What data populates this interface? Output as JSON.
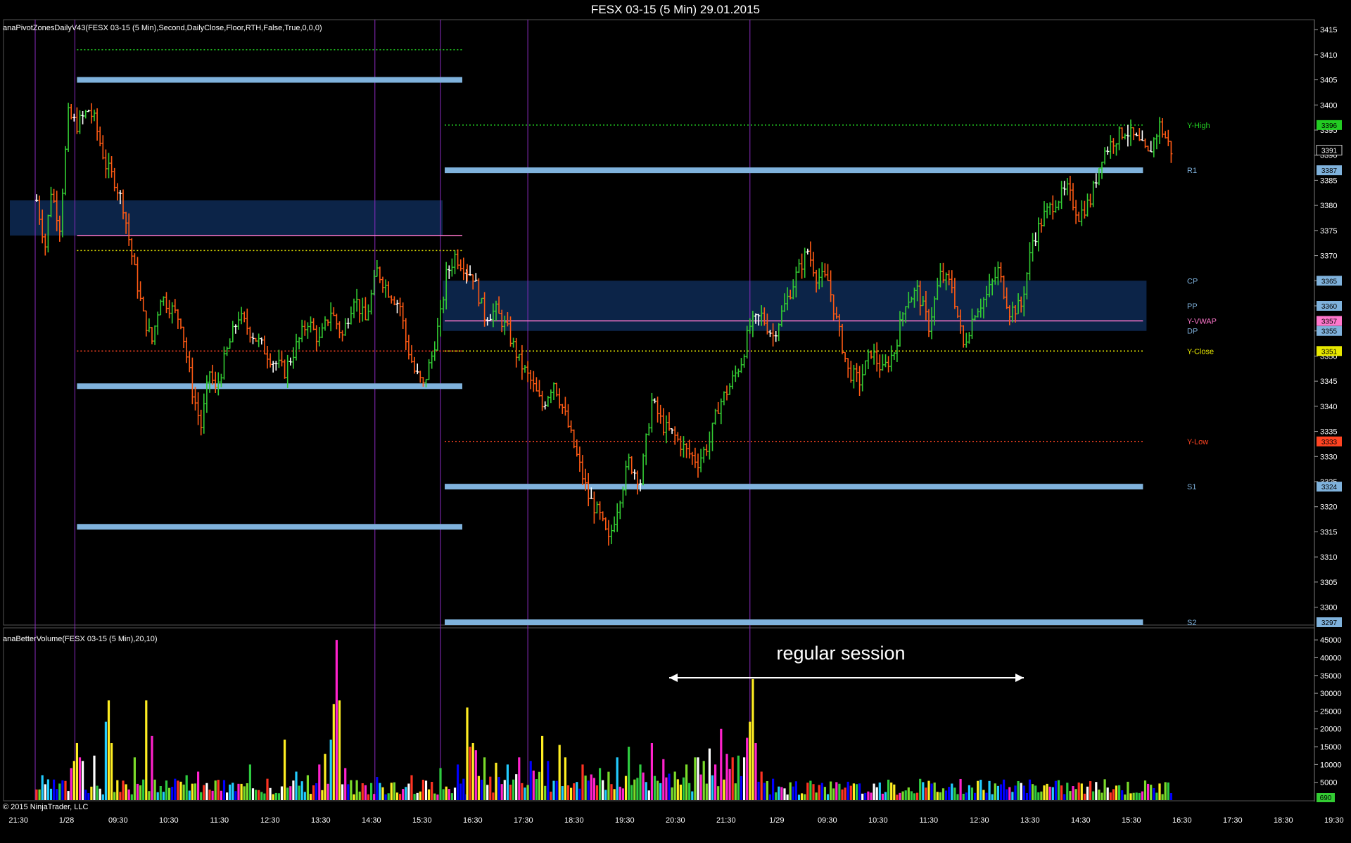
{
  "window": {
    "title": "FESX 03-15 (5 Min)  29.01.2015",
    "copyright": "© 2015 NinjaTrader, LLC"
  },
  "colors": {
    "background": "#000000",
    "up_bar": "#33cc33",
    "down_bar": "#ff5a14",
    "pivot_zone": "#7fb2dc",
    "zone_fill": "#0e2a55",
    "y_high": "#22cc22",
    "y_low": "#ff4422",
    "y_close": "#e8e800",
    "y_vwap": "#ff77cc",
    "session_line": "#8a2bbf"
  },
  "chart_data": [
    {
      "type": "candlestick",
      "indicator_label": "anaPivotZonesDailyV43(FESX 03-15 (5 Min),Second,DailyClose,Floor,RTH,False,True,0,0,0)",
      "y_ticks": [
        3300,
        3305,
        3310,
        3315,
        3320,
        3325,
        3330,
        3335,
        3340,
        3345,
        3350,
        3355,
        3360,
        3365,
        3370,
        3375,
        3380,
        3385,
        3390,
        3395,
        3400,
        3405,
        3410,
        3415
      ],
      "ylim": [
        3297,
        3416
      ],
      "x_ticks": [
        "21:30",
        "1/28",
        "09:30",
        "10:30",
        "11:30",
        "12:30",
        "13:30",
        "14:30",
        "15:30",
        "16:30",
        "17:30",
        "18:30",
        "19:30",
        "20:30",
        "21:30",
        "1/29",
        "09:30",
        "10:30",
        "11:30",
        "12:30",
        "13:30",
        "14:30",
        "15:30",
        "16:30",
        "17:30",
        "18:30",
        "19:30",
        "20:30"
      ],
      "price_path": [
        [
          0,
          3381
        ],
        [
          3,
          3372
        ],
        [
          5,
          3383
        ],
        [
          8,
          3376
        ],
        [
          11,
          3398
        ],
        [
          14,
          3396
        ],
        [
          18,
          3399
        ],
        [
          20,
          3397
        ],
        [
          24,
          3388
        ],
        [
          27,
          3385
        ],
        [
          30,
          3380
        ],
        [
          33,
          3370
        ],
        [
          37,
          3358
        ],
        [
          40,
          3353
        ],
        [
          43,
          3362
        ],
        [
          46,
          3360
        ],
        [
          50,
          3357
        ],
        [
          54,
          3343
        ],
        [
          57,
          3336
        ],
        [
          60,
          3347
        ],
        [
          62,
          3343
        ],
        [
          66,
          3351
        ],
        [
          70,
          3358
        ],
        [
          74,
          3355
        ],
        [
          78,
          3352
        ],
        [
          82,
          3349
        ],
        [
          86,
          3347
        ],
        [
          90,
          3352
        ],
        [
          94,
          3357
        ],
        [
          98,
          3353
        ],
        [
          102,
          3359
        ],
        [
          106,
          3354
        ],
        [
          110,
          3362
        ],
        [
          114,
          3357
        ],
        [
          118,
          3367
        ],
        [
          122,
          3363
        ],
        [
          126,
          3360
        ],
        [
          128,
          3353
        ],
        [
          131,
          3347
        ],
        [
          134,
          3344
        ],
        [
          137,
          3350
        ],
        [
          140,
          3358
        ],
        [
          142,
          3366
        ],
        [
          145,
          3370
        ],
        [
          148,
          3368
        ],
        [
          152,
          3366
        ],
        [
          156,
          3358
        ],
        [
          160,
          3359
        ],
        [
          164,
          3355
        ],
        [
          168,
          3349
        ],
        [
          172,
          3345
        ],
        [
          176,
          3340
        ],
        [
          180,
          3345
        ],
        [
          184,
          3338
        ],
        [
          188,
          3330
        ],
        [
          192,
          3322
        ],
        [
          196,
          3318
        ],
        [
          199,
          3313
        ],
        [
          202,
          3320
        ],
        [
          206,
          3329
        ],
        [
          210,
          3325
        ],
        [
          214,
          3341
        ],
        [
          218,
          3336
        ],
        [
          222,
          3334
        ],
        [
          226,
          3331
        ],
        [
          230,
          3329
        ],
        [
          234,
          3333
        ],
        [
          237,
          3340
        ],
        [
          241,
          3344
        ],
        [
          245,
          3349
        ],
        [
          248,
          3356
        ],
        [
          252,
          3358
        ],
        [
          256,
          3354
        ],
        [
          260,
          3360
        ],
        [
          264,
          3366
        ],
        [
          268,
          3371
        ],
        [
          271,
          3366
        ],
        [
          275,
          3365
        ],
        [
          278,
          3357
        ],
        [
          282,
          3347
        ],
        [
          286,
          3345
        ],
        [
          290,
          3351
        ],
        [
          294,
          3347
        ],
        [
          298,
          3351
        ],
        [
          302,
          3361
        ],
        [
          306,
          3363
        ],
        [
          310,
          3356
        ],
        [
          314,
          3366
        ],
        [
          318,
          3364
        ],
        [
          322,
          3352
        ],
        [
          326,
          3359
        ],
        [
          330,
          3362
        ],
        [
          334,
          3367
        ],
        [
          338,
          3359
        ],
        [
          342,
          3360
        ],
        [
          346,
          3373
        ],
        [
          350,
          3378
        ],
        [
          354,
          3381
        ],
        [
          358,
          3383
        ],
        [
          362,
          3378
        ],
        [
          366,
          3381
        ],
        [
          370,
          3390
        ],
        [
          374,
          3393
        ],
        [
          378,
          3395
        ],
        [
          382,
          3393
        ],
        [
          386,
          3390
        ],
        [
          390,
          3396
        ],
        [
          394,
          3391
        ]
      ],
      "session_breaks": [
        14,
        118,
        171,
        248
      ],
      "right_session_start": 150,
      "levels_left": [
        {
          "price": 3411,
          "style": "dotted",
          "color": "y_high",
          "x0": 14,
          "x1": 150
        },
        {
          "price": 3405,
          "style": "band",
          "color": "pivot_zone",
          "x0": 14,
          "x1": 150
        },
        {
          "price": 3374,
          "style": "line",
          "color": "y_vwap",
          "x0": 14,
          "x1": 150
        },
        {
          "price": 3371,
          "style": "dotted",
          "color": "y_close",
          "x0": 14,
          "x1": 150
        },
        {
          "price": 3351,
          "style": "dotted",
          "color": "y_low",
          "x0": 14,
          "x1": 150
        },
        {
          "price": 3344,
          "style": "band",
          "color": "pivot_zone",
          "x0": 14,
          "x1": 150
        },
        {
          "price": 3316,
          "style": "band",
          "color": "pivot_zone",
          "x0": 14,
          "x1": 150
        }
      ],
      "zones_left": [
        [
          3381,
          3374
        ]
      ],
      "levels_right": [
        {
          "label": "Y-High",
          "price": 3396,
          "style": "dotted",
          "color": "y_high",
          "tag": "3396"
        },
        {
          "label": "R1",
          "price": 3387,
          "style": "band",
          "color": "pivot_zone",
          "tag": "3387"
        },
        {
          "label": "CP",
          "price": 3365,
          "style": "none",
          "color": "pivot_zone",
          "tag": "3365"
        },
        {
          "label": "PP",
          "price": 3360,
          "style": "none",
          "color": "pivot_zone",
          "tag": "3360"
        },
        {
          "label": "Y-VWAP",
          "price": 3357,
          "style": "line",
          "color": "y_vwap",
          "tag": "3357"
        },
        {
          "label": "DP",
          "price": 3355,
          "style": "none",
          "color": "pivot_zone",
          "tag": "3355"
        },
        {
          "label": "Y-Close",
          "price": 3351,
          "style": "dotted",
          "color": "y_close",
          "tag": "3351"
        },
        {
          "label": "Y-Low",
          "price": 3333,
          "style": "dotted",
          "color": "y_low",
          "tag": "3333"
        },
        {
          "label": "S1",
          "price": 3324,
          "style": "band",
          "color": "pivot_zone",
          "tag": "3324"
        },
        {
          "label": "S2",
          "price": 3297,
          "style": "band",
          "color": "pivot_zone",
          "tag": "3297"
        }
      ],
      "zones_right": [
        [
          3365,
          3360
        ],
        [
          3360,
          3355
        ]
      ],
      "last_price": "3391"
    },
    {
      "type": "bar",
      "indicator_label": "anaBetterVolume(FESX 03-15 (5 Min),20,10)",
      "y_ticks": [
        5000,
        10000,
        15000,
        20000,
        25000,
        30000,
        35000,
        40000,
        45000
      ],
      "ylim": [
        0,
        47000
      ],
      "annotation": "regular session",
      "annotation_range": [
        149,
        248
      ],
      "last_volume": "690",
      "spikes": [
        [
          1,
          3000
        ],
        [
          2,
          7000
        ],
        [
          12,
          9000
        ],
        [
          13,
          11000
        ],
        [
          14,
          16000
        ],
        [
          15,
          12000
        ],
        [
          16,
          11000
        ],
        [
          20,
          12500
        ],
        [
          24,
          22000
        ],
        [
          25,
          28000
        ],
        [
          26,
          16000
        ],
        [
          34,
          12000
        ],
        [
          38,
          28000
        ],
        [
          40,
          18000
        ],
        [
          45,
          5500
        ],
        [
          48,
          6000
        ],
        [
          52,
          7000
        ],
        [
          56,
          8000
        ],
        [
          62,
          5500
        ],
        [
          74,
          10000
        ],
        [
          80,
          6000
        ],
        [
          86,
          17000
        ],
        [
          90,
          8000
        ],
        [
          94,
          7000
        ],
        [
          98,
          10000
        ],
        [
          100,
          13000
        ],
        [
          102,
          17000
        ],
        [
          103,
          27000
        ],
        [
          104,
          45000
        ],
        [
          105,
          28000
        ],
        [
          107,
          9000
        ],
        [
          118,
          6500
        ],
        [
          124,
          5000
        ],
        [
          130,
          7000
        ],
        [
          140,
          9000
        ],
        [
          146,
          10000
        ],
        [
          148,
          6000
        ],
        [
          150,
          26000
        ],
        [
          151,
          15000
        ],
        [
          152,
          16000
        ],
        [
          153,
          14000
        ],
        [
          156,
          12000
        ],
        [
          160,
          10500
        ],
        [
          164,
          10000
        ],
        [
          168,
          12000
        ],
        [
          172,
          11000
        ],
        [
          176,
          18000
        ],
        [
          178,
          11000
        ],
        [
          182,
          15500
        ],
        [
          184,
          12000
        ],
        [
          190,
          10000
        ],
        [
          196,
          9000
        ],
        [
          202,
          12000
        ],
        [
          206,
          15000
        ],
        [
          210,
          10000
        ],
        [
          214,
          16000
        ],
        [
          218,
          11500
        ],
        [
          222,
          8000
        ],
        [
          226,
          10000
        ],
        [
          229,
          12000
        ],
        [
          230,
          12000
        ],
        [
          232,
          11000
        ],
        [
          234,
          14500
        ],
        [
          236,
          10000
        ],
        [
          238,
          20000
        ],
        [
          240,
          13000
        ],
        [
          242,
          12000
        ],
        [
          244,
          12500
        ],
        [
          246,
          12000
        ],
        [
          247,
          17500
        ],
        [
          248,
          22000
        ],
        [
          249,
          34000
        ],
        [
          250,
          16000
        ],
        [
          252,
          8000
        ],
        [
          256,
          6000
        ],
        [
          262,
          5000
        ],
        [
          270,
          4500
        ],
        [
          280,
          3000
        ],
        [
          288,
          2000
        ]
      ]
    }
  ]
}
